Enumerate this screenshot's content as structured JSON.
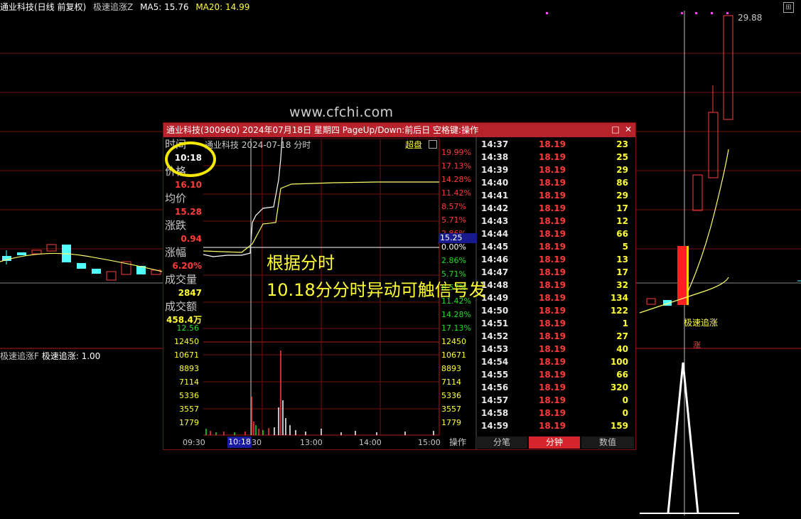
{
  "header": {
    "stock": "通业科技(日线 前复权)",
    "indicator": "极速追涨Z",
    "ma5_label": "MA5: 15.76",
    "ma20_label": "MA20: 14.99"
  },
  "sub_header": {
    "indicator": "极速追涨F",
    "value_label": "极速追涨: 1.00"
  },
  "watermark": "www.cfchi.com",
  "annotation": {
    "line1": "根据分时",
    "line2": "10.18分分时异动可触信号发"
  },
  "price_high_label": "29.88",
  "signal_label": "极速追涨",
  "signal_label2": "涨",
  "popup": {
    "title": "通业科技(300960) 2024年07月18日 星期四 PageUp/Down:前后日 空格键:操作",
    "subheader": "通业科技 2024-07-18 分时",
    "chaopan": "超盘",
    "info": [
      {
        "label": "时间",
        "value": "10:18"
      },
      {
        "label": "价格",
        "value": "16.10"
      },
      {
        "label": "均价",
        "value": "15.28"
      },
      {
        "label": "涨跌",
        "value": "0.94"
      },
      {
        "label": "涨幅",
        "value": "6.20%"
      },
      {
        "label": "成交量",
        "value": "2847"
      },
      {
        "label": "成交额",
        "value": "458.4万"
      }
    ],
    "left_price_tick": "12.56",
    "pct_ticks_up": [
      "19.99%",
      "17.13%",
      "14.28%",
      "11.42%",
      "8.57%",
      "5.71%",
      "2.86%",
      "0.00%"
    ],
    "pct_ticks_down": [
      "2.86%",
      "5.71%",
      "8.57%",
      "11.42%",
      "14.28%",
      "17.13%"
    ],
    "vol_ticks": [
      "12450",
      "10671",
      "8893",
      "7114",
      "5336",
      "3557",
      "1779"
    ],
    "price_tag": "15.25",
    "time_axis": [
      "09:30",
      "30",
      "13:00",
      "14:00",
      "15:00"
    ],
    "time_cursor": "10:18",
    "ops_label": "操作",
    "ticks": [
      {
        "time": "14:37",
        "price": "18.19",
        "vol": "23"
      },
      {
        "time": "14:38",
        "price": "18.19",
        "vol": "25"
      },
      {
        "time": "14:39",
        "price": "18.19",
        "vol": "29"
      },
      {
        "time": "14:40",
        "price": "18.19",
        "vol": "86"
      },
      {
        "time": "14:41",
        "price": "18.19",
        "vol": "29"
      },
      {
        "time": "14:42",
        "price": "18.19",
        "vol": "17"
      },
      {
        "time": "14:43",
        "price": "18.19",
        "vol": "12"
      },
      {
        "time": "14:44",
        "price": "18.19",
        "vol": "66"
      },
      {
        "time": "14:45",
        "price": "18.19",
        "vol": "5"
      },
      {
        "time": "14:46",
        "price": "18.19",
        "vol": "13"
      },
      {
        "time": "14:47",
        "price": "18.19",
        "vol": "17"
      },
      {
        "time": "14:48",
        "price": "18.19",
        "vol": "32"
      },
      {
        "time": "14:49",
        "price": "18.19",
        "vol": "134"
      },
      {
        "time": "14:50",
        "price": "18.19",
        "vol": "122"
      },
      {
        "time": "14:51",
        "price": "18.19",
        "vol": "1"
      },
      {
        "time": "14:52",
        "price": "18.19",
        "vol": "27"
      },
      {
        "time": "14:53",
        "price": "18.19",
        "vol": "40"
      },
      {
        "time": "14:54",
        "price": "18.19",
        "vol": "100"
      },
      {
        "time": "14:55",
        "price": "18.19",
        "vol": "66"
      },
      {
        "time": "14:56",
        "price": "18.19",
        "vol": "320"
      },
      {
        "time": "14:57",
        "price": "18.19",
        "vol": "0"
      },
      {
        "time": "14:58",
        "price": "18.19",
        "vol": "0"
      },
      {
        "time": "14:59",
        "price": "18.19",
        "vol": "159"
      }
    ],
    "tabs": [
      "分笔",
      "分钟",
      "数值"
    ],
    "active_tab": "分钟"
  },
  "colors": {
    "up": "#ff3c3c",
    "down": "#54ffff",
    "ma": "#ffff66",
    "popup_title": "#b8222a"
  }
}
